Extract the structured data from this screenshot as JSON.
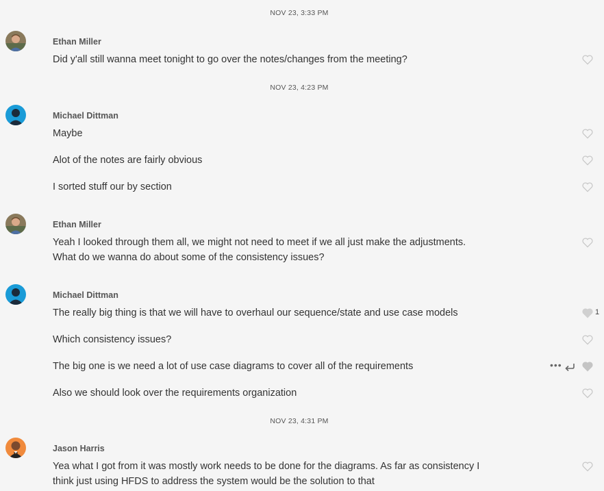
{
  "colors": {
    "background": "#f5f5f5",
    "heart_outline": "#c8c8c8",
    "heart_filled": "#d0d0d0",
    "michael_avatar": "#1a9bd7",
    "jason_avatar": "#f08a3c"
  },
  "timestamps": [
    "NOV 23, 3:33 PM",
    "NOV 23, 4:23 PM",
    "NOV 23, 4:31 PM"
  ],
  "groups": [
    {
      "sender": "Ethan Miller",
      "avatar_icon": "ethan-photo-avatar",
      "messages": [
        "Did y'all still wanna meet tonight to go over the notes/changes from the meeting?"
      ]
    },
    {
      "sender": "Michael Dittman",
      "avatar_icon": "default-person-avatar",
      "messages": [
        "Maybe",
        "Alot of the notes are fairly obvious",
        "I sorted stuff our by section"
      ]
    },
    {
      "sender": "Ethan Miller",
      "avatar_icon": "ethan-photo-avatar",
      "messages": [
        "Yeah I looked through them all, we might not need to meet if we all just make the adjustments.",
        "What do we wanna do about some of the consistency issues?"
      ]
    },
    {
      "sender": "Michael Dittman",
      "avatar_icon": "default-person-avatar",
      "messages": [
        "The really big thing is that we will have to overhaul our sequence/state and use case models",
        "Which consistency issues?",
        "The big one is we need a lot of use case diagrams to cover all of the requirements",
        "Also we should look over the requirements organization"
      ],
      "like_count": "1"
    },
    {
      "sender": "Jason Harris",
      "avatar_icon": "jason-photo-avatar",
      "messages": [
        "Yea what I got from it was mostly work needs to be done for the diagrams. As far as consistency I",
        "think just using HFDS to address the system would be the solution to that"
      ]
    }
  ],
  "hover_actions": {
    "more": "•••"
  }
}
